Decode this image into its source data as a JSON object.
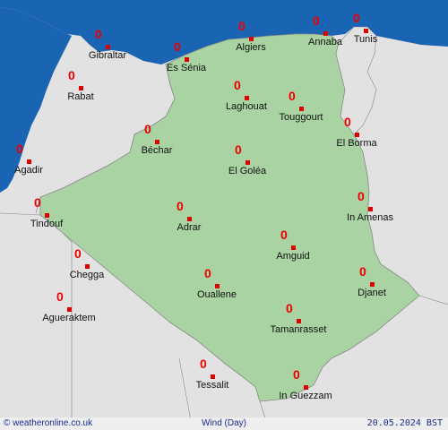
{
  "footer": {
    "credit": "© weatheronline.co.uk",
    "parameter": "Wind (Day)",
    "date": "20.05.2024 BST"
  },
  "colors": {
    "sea": "#1a64b4",
    "land": "#e2e2e2",
    "country": "#a9d3a2",
    "marker": "#dd0000",
    "value": "#ee0000"
  },
  "stations": [
    {
      "name": "Gibraltar",
      "value": "0"
    },
    {
      "name": "Algiers",
      "value": "0"
    },
    {
      "name": "Annaba",
      "value": "0"
    },
    {
      "name": "Tunis",
      "value": "0"
    },
    {
      "name": "Es Sénia",
      "value": "0"
    },
    {
      "name": "Rabat",
      "value": "0"
    },
    {
      "name": "Laghouat",
      "value": "0"
    },
    {
      "name": "Touggourt",
      "value": "0"
    },
    {
      "name": "Béchar",
      "value": "0"
    },
    {
      "name": "El Borma",
      "value": "0"
    },
    {
      "name": "Agadir",
      "value": "0"
    },
    {
      "name": "El Goléa",
      "value": "0"
    },
    {
      "name": "Tindouf",
      "value": "0"
    },
    {
      "name": "Adrar",
      "value": "0"
    },
    {
      "name": "In Amenas",
      "value": "0"
    },
    {
      "name": "Amguid",
      "value": "0"
    },
    {
      "name": "Chegga",
      "value": "0"
    },
    {
      "name": "Djanet",
      "value": "0"
    },
    {
      "name": "Ouallene",
      "value": "0"
    },
    {
      "name": "Agueraktem",
      "value": "0"
    },
    {
      "name": "Tamanrasset",
      "value": "0"
    },
    {
      "name": "Tessalit",
      "value": "0"
    },
    {
      "name": "In Guezzam",
      "value": "0"
    }
  ]
}
